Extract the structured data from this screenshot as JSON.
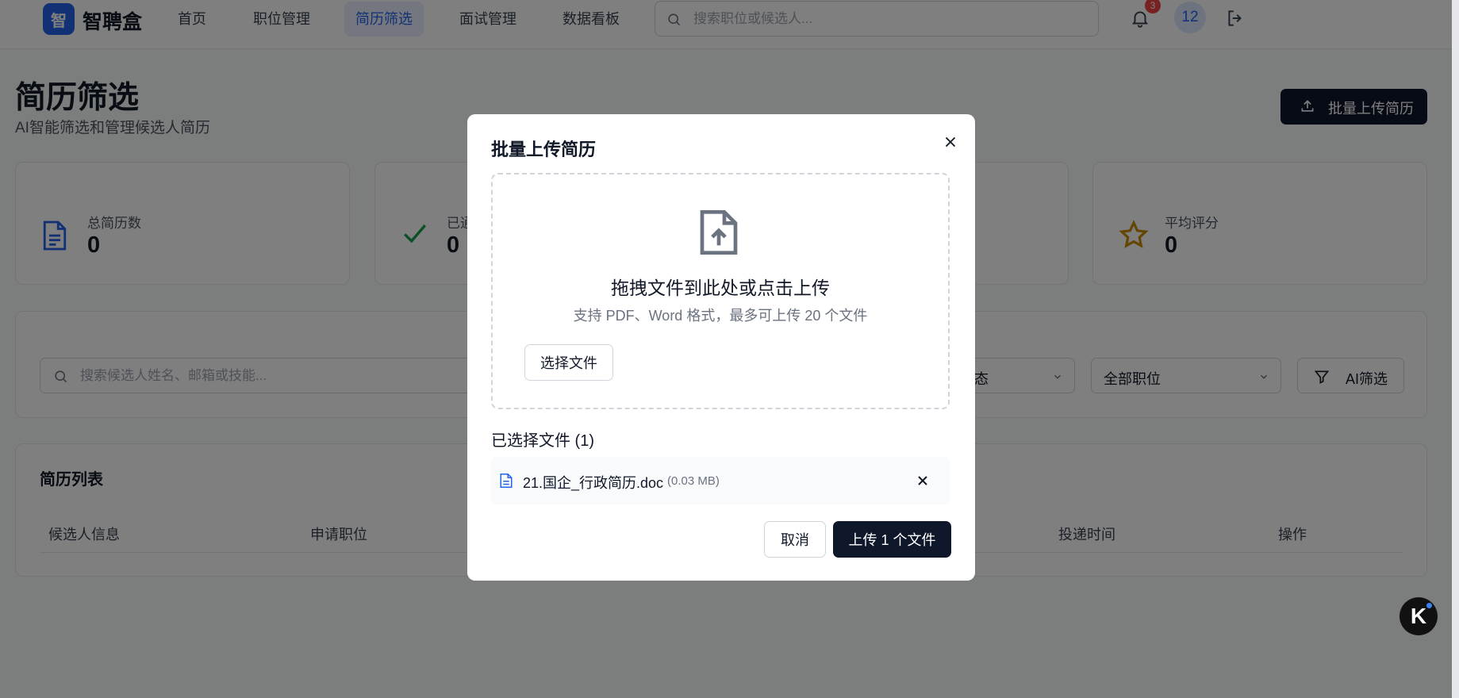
{
  "app": {
    "logo_char": "智",
    "name": "智聘盒"
  },
  "nav": {
    "items": [
      "首页",
      "职位管理",
      "简历筛选",
      "面试管理",
      "数据看板"
    ],
    "active": "简历筛选"
  },
  "header": {
    "search_placeholder": "搜索职位或候选人...",
    "notification_count": "3",
    "avatar_text": "12"
  },
  "page": {
    "title": "简历筛选",
    "subtitle": "AI智能筛选和管理候选人简历",
    "bulk_upload_label": "批量上传简历"
  },
  "stats": [
    {
      "label": "总简历数",
      "value": "0",
      "icon": "document-icon",
      "color": "#2563eb"
    },
    {
      "label": "已通",
      "value": "0",
      "icon": "check-icon",
      "color": "#16a34a"
    },
    {
      "label": "平均评分",
      "value": "0",
      "icon": "star-icon",
      "color": "#ca8a04"
    }
  ],
  "filters": {
    "search_placeholder": "搜索候选人姓名、邮箱或技能...",
    "status_select_visible": "态",
    "position_select": "全部职位",
    "ai_filter_label": "AI筛选"
  },
  "list": {
    "title": "简历列表",
    "columns": [
      "候选人信息",
      "申请职位",
      "投递时间",
      "操作"
    ]
  },
  "modal": {
    "title": "批量上传简历",
    "drop_title": "拖拽文件到此处或点击上传",
    "drop_subtitle": "支持 PDF、Word 格式，最多可上传 20 个文件",
    "choose_button": "选择文件",
    "selected_title": "已选择文件 (1)",
    "files": [
      {
        "name": "21.国企_行政简历.doc",
        "size": "(0.03 MB)"
      }
    ],
    "cancel_label": "取消",
    "submit_label": "上传 1 个文件"
  },
  "floating_badge": "K"
}
